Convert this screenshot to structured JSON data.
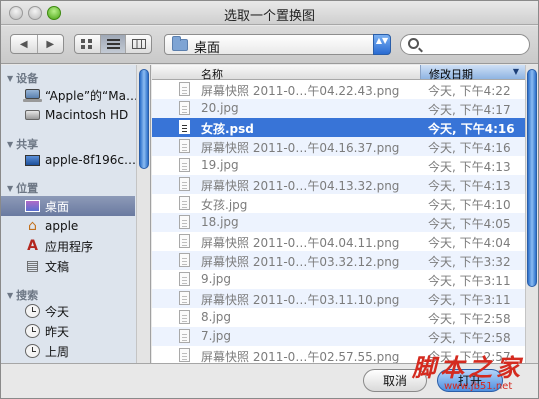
{
  "window": {
    "title": "选取一个置换图"
  },
  "toolbar": {
    "back_glyph": "◀",
    "forward_glyph": "▶",
    "view_icons": [
      "icon-view-icon",
      "list-view-icon",
      "column-view-icon"
    ],
    "location": "桌面",
    "stepper_glyph": "▲▼"
  },
  "sidebar": {
    "sections": [
      {
        "label": "设备",
        "items": [
          {
            "label": "“Apple”的“Ma…",
            "icon": "laptop-icon"
          },
          {
            "label": "Macintosh HD",
            "icon": "disk-icon"
          }
        ]
      },
      {
        "label": "共享",
        "items": [
          {
            "label": "apple-8f196c…",
            "icon": "monitor-icon"
          }
        ]
      },
      {
        "label": "位置",
        "items": [
          {
            "label": "桌面",
            "icon": "desktop-icon",
            "selected": true
          },
          {
            "label": "apple",
            "icon": "home-icon"
          },
          {
            "label": "应用程序",
            "icon": "applications-icon"
          },
          {
            "label": "文稿",
            "icon": "documents-icon"
          }
        ]
      },
      {
        "label": "搜索",
        "items": [
          {
            "label": "今天",
            "icon": "clock-icon"
          },
          {
            "label": "昨天",
            "icon": "clock-icon"
          },
          {
            "label": "上周",
            "icon": "clock-icon"
          }
        ]
      }
    ]
  },
  "list": {
    "columns": {
      "name": "名称",
      "date": "修改日期",
      "sort_arrow": "▼"
    },
    "files": [
      {
        "name": "屏幕快照 2011-0…午04.22.43.png",
        "date": "今天, 下午4:22"
      },
      {
        "name": "20.jpg",
        "date": "今天, 下午4:17"
      },
      {
        "name": "女孩.psd",
        "date": "今天, 下午4:16",
        "selected": true
      },
      {
        "name": "屏幕快照 2011-0…午04.16.37.png",
        "date": "今天, 下午4:16"
      },
      {
        "name": "19.jpg",
        "date": "今天, 下午4:13"
      },
      {
        "name": "屏幕快照 2011-0…午04.13.32.png",
        "date": "今天, 下午4:13"
      },
      {
        "name": "女孩.jpg",
        "date": "今天, 下午4:10"
      },
      {
        "name": "18.jpg",
        "date": "今天, 下午4:05"
      },
      {
        "name": "屏幕快照 2011-0…午04.04.11.png",
        "date": "今天, 下午4:04"
      },
      {
        "name": "屏幕快照 2011-0…午03.32.12.png",
        "date": "今天, 下午3:32"
      },
      {
        "name": "9.jpg",
        "date": "今天, 下午3:11"
      },
      {
        "name": "屏幕快照 2011-0…午03.11.10.png",
        "date": "今天, 下午3:11"
      },
      {
        "name": "8.jpg",
        "date": "今天, 下午2:58"
      },
      {
        "name": "7.jpg",
        "date": "今天, 下午2:58"
      },
      {
        "name": "屏幕快照 2011-0…午02.57.55.png",
        "date": "今天, 下午2:57"
      }
    ]
  },
  "footer": {
    "cancel_label": "取消",
    "open_label": "打开"
  },
  "watermark": {
    "text": "脚本之家",
    "url": "www.jb51.net"
  }
}
